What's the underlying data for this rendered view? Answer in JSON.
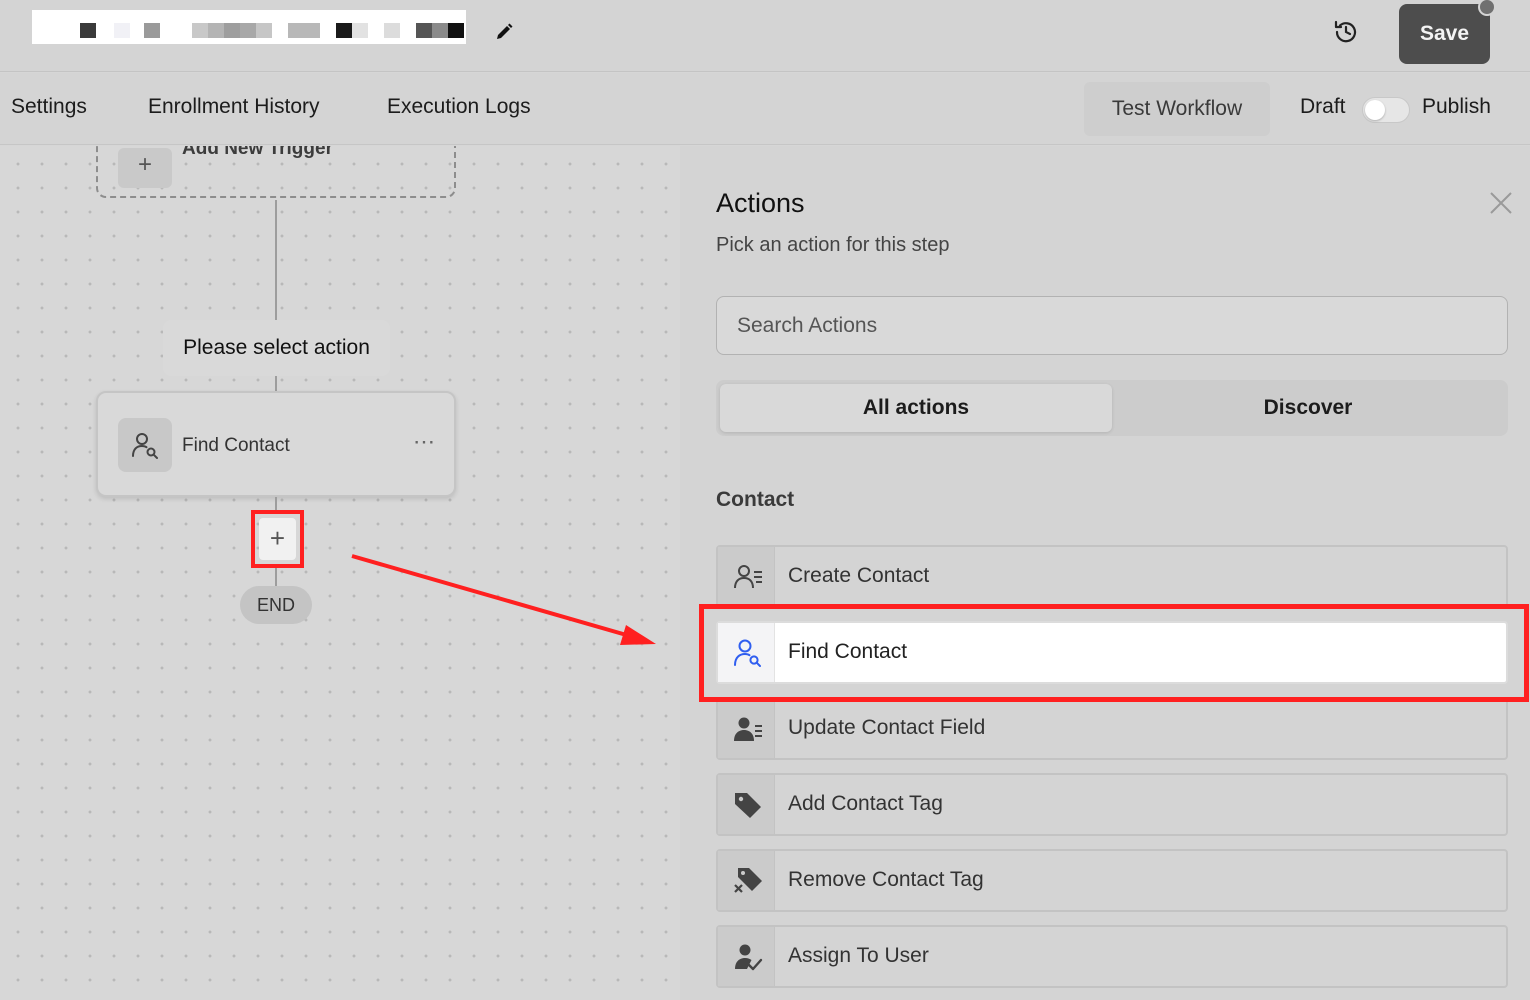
{
  "header": {
    "workflow_name_redacted": true,
    "save_label": "Save"
  },
  "nav": {
    "tabs": [
      "Settings",
      "Enrollment History",
      "Execution Logs"
    ],
    "test_workflow_label": "Test Workflow",
    "draft_label": "Draft",
    "publish_label": "Publish",
    "published": false
  },
  "canvas": {
    "trigger_label": "Add New Trigger",
    "trigger_icon": "+",
    "select_action_label": "Please select action",
    "action_card_label": "Find Contact",
    "action_card_menu": "⋯",
    "add_step_icon": "+",
    "end_label": "END"
  },
  "panel": {
    "title": "Actions",
    "subtitle": "Pick an action for this step",
    "search_placeholder": "Search Actions",
    "tabs": [
      "All actions",
      "Discover"
    ],
    "active_tab": "All actions",
    "section_title": "Contact",
    "items": [
      {
        "label": "Create Contact",
        "icon": "user-list-icon"
      },
      {
        "label": "Find Contact",
        "icon": "user-search-icon",
        "selected": true
      },
      {
        "label": "Update Contact Field",
        "icon": "user-edit-icon"
      },
      {
        "label": "Add Contact Tag",
        "icon": "tag-icon"
      },
      {
        "label": "Remove Contact Tag",
        "icon": "tag-remove-icon"
      },
      {
        "label": "Assign To User",
        "icon": "user-check-icon"
      }
    ]
  },
  "colors": {
    "highlight": "#ff2020",
    "selected_icon": "#2f5ef0",
    "save_button": "#4d4d4d"
  }
}
